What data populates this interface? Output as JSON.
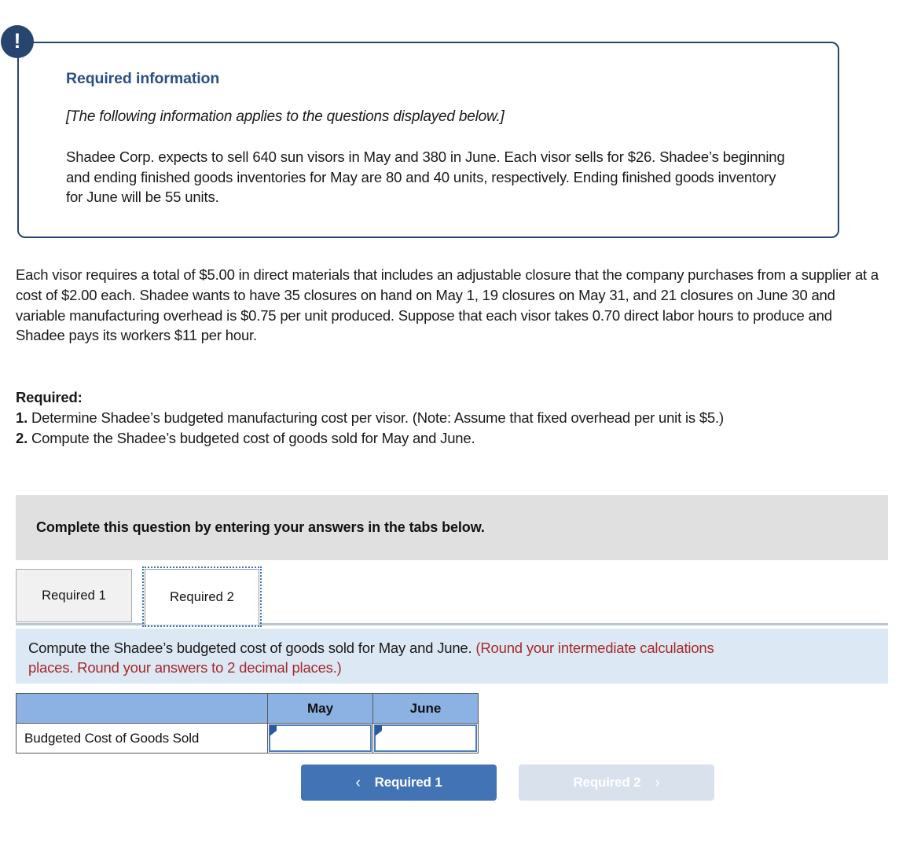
{
  "callout": {
    "badge_icon": "exclamation-icon",
    "badge_glyph": "!",
    "title": "Required information",
    "italic_note": "[The following information applies to the questions displayed below.]",
    "body": "Shadee Corp. expects to sell 640 sun visors in May and 380 in June. Each visor sells for $26. Shadee’s beginning and ending finished goods inventories for May are 80 and 40 units, respectively. Ending finished goods inventory for June will be 55 units."
  },
  "main_paragraph": "Each visor requires a total of $5.00 in direct materials that includes an adjustable closure that the company purchases from a supplier at a cost of $2.00 each. Shadee wants to have 35 closures on hand on May 1, 19 closures on May 31, and 21 closures on June 30 and variable manufacturing overhead is $0.75 per unit produced. Suppose that each visor takes 0.70 direct labor hours to produce and Shadee pays its workers $11 per hour.",
  "required": {
    "heading": "Required:",
    "items": [
      {
        "number": "1.",
        "text": " Determine Shadee’s budgeted manufacturing cost per visor. (Note: Assume that fixed overhead per unit is $5.)"
      },
      {
        "number": "2.",
        "text": " Compute the Shadee’s budgeted cost of goods sold for May and June."
      }
    ]
  },
  "instruction_bar": {
    "text": "Complete this question by entering your answers in the tabs below."
  },
  "tabs": [
    {
      "label": "Required 1",
      "active": false
    },
    {
      "label": "Required 2",
      "active": true
    }
  ],
  "question_panel": {
    "prompt": "Compute the Shadee’s budgeted cost of goods sold for May and June. ",
    "note_line1": "(Round your intermediate calculations",
    "note_line2": "places. Round your answers to 2 decimal places.)"
  },
  "answer_table": {
    "columns": [
      "",
      "May",
      "June"
    ],
    "rows": [
      {
        "label": "Budgeted Cost of Goods Sold",
        "may": "",
        "june": ""
      }
    ]
  },
  "nav": {
    "prev_label": "Required 1",
    "prev_icon": "chevron-left-icon",
    "prev_glyph": "‹",
    "next_label": "Required 2",
    "next_icon": "chevron-right-icon",
    "next_glyph": "›"
  },
  "colors": {
    "callout_border": "#27456f",
    "callout_title": "#2c4f86",
    "instruction_bar_bg": "#e0e0e0",
    "question_panel_bg": "#dde8f5",
    "note_red": "#a52a2a",
    "table_header_blue": "#8cb1e3",
    "input_border_blue": "#4a7ebb",
    "button_active_blue": "#4273b4",
    "button_disabled_blue": "#d9e1ed"
  }
}
